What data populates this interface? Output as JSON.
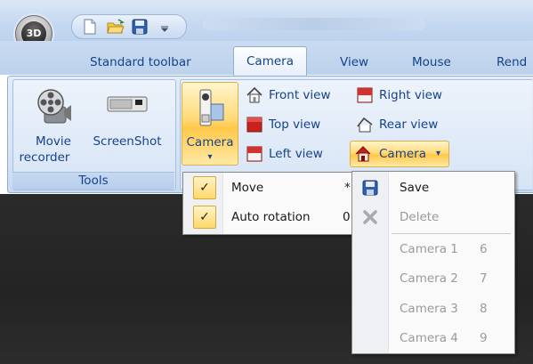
{
  "app": {
    "orb_label": "3D"
  },
  "tabs": [
    {
      "label": "Standard toolbar"
    },
    {
      "label": "Camera",
      "active": true
    },
    {
      "label": "View"
    },
    {
      "label": "Mouse"
    },
    {
      "label": "Rend"
    }
  ],
  "ribbon": {
    "tools_group": {
      "label": "Tools",
      "movie_recorder": {
        "line1": "Movie",
        "line2": "recorder",
        "icon": "film-reel-icon"
      },
      "screenshot": {
        "label": "ScreenShot",
        "icon": "camera-body-icon"
      }
    },
    "camera_group": {
      "camera_button": {
        "label": "Camera",
        "icon": "video-camera-icon"
      },
      "front_view": "Front view",
      "top_view": "Top view",
      "left_view": "Left view",
      "right_view": "Right view",
      "rear_view": "Rear view",
      "camera_menu": "Camera"
    }
  },
  "menu_left": {
    "items": [
      {
        "label": "Move",
        "shortcut": "*",
        "checked": true
      },
      {
        "label": "Auto rotation",
        "shortcut": "0",
        "checked": true
      }
    ]
  },
  "menu_right": {
    "save": "Save",
    "delete": "Delete",
    "cameras": [
      {
        "label": "Camera 1",
        "shortcut": "6"
      },
      {
        "label": "Camera 2",
        "shortcut": "7"
      },
      {
        "label": "Camera 3",
        "shortcut": "8"
      },
      {
        "label": "Camera 4",
        "shortcut": "9"
      }
    ]
  },
  "colors": {
    "ribbon_text": "#15428b",
    "highlight": "#ffd977",
    "viewport": "#262626"
  }
}
